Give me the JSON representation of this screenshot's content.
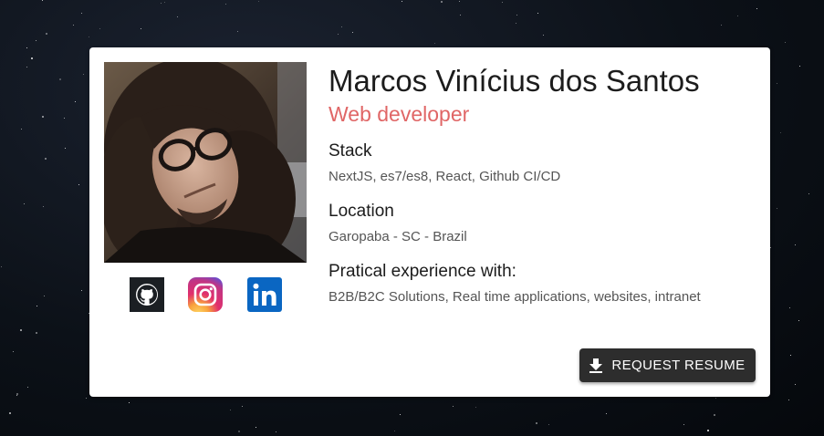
{
  "profile": {
    "name": "Marcos Vinícius dos Santos",
    "role": "Web developer"
  },
  "sections": {
    "stack": {
      "title": "Stack",
      "text": "NextJS, es7/es8, React, Github CI/CD"
    },
    "location": {
      "title": "Location",
      "text": "Garopaba - SC - Brazil"
    },
    "experience": {
      "title": "Pratical experience with:",
      "text": "B2B/B2C Solutions, Real time applications, websites, intranet"
    }
  },
  "socials": [
    {
      "icon": "github-icon",
      "color": "#1b1f23"
    },
    {
      "icon": "instagram-icon",
      "color": "#e1306c"
    },
    {
      "icon": "linkedin-icon",
      "color": "#0a66c2"
    }
  ],
  "actions": {
    "request_resume_label": "Request resume",
    "request_resume_icon": "download-icon"
  },
  "colors": {
    "accent": "#e06666",
    "button_bg": "#2d2d2d",
    "card_bg": "#ffffff"
  }
}
